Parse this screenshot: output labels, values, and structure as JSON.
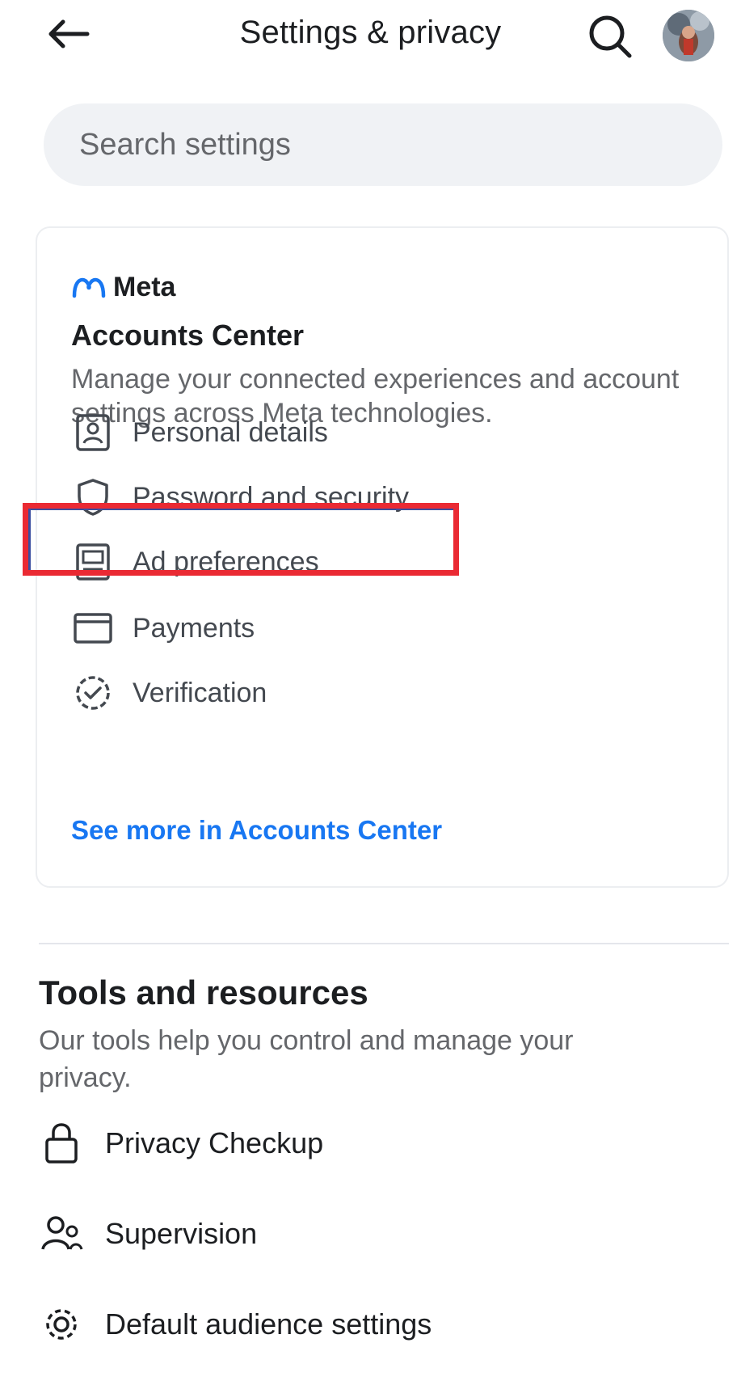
{
  "header": {
    "title": "Settings & privacy"
  },
  "search": {
    "placeholder": "Search settings"
  },
  "accounts_center": {
    "brand": "Meta",
    "title": "Accounts Center",
    "description": "Manage your connected experiences and account settings across Meta technologies.",
    "items": [
      {
        "label": "Personal details",
        "icon": "id-card-icon"
      },
      {
        "label": "Password and security",
        "icon": "shield-icon"
      },
      {
        "label": "Ad preferences",
        "icon": "ad-preferences-icon"
      },
      {
        "label": "Payments",
        "icon": "payment-card-icon"
      },
      {
        "label": "Verification",
        "icon": "verified-badge-icon"
      }
    ],
    "see_more": "See more in Accounts Center"
  },
  "tools": {
    "title": "Tools and resources",
    "description": "Our tools help you control and manage your privacy.",
    "items": [
      {
        "label": "Privacy Checkup",
        "icon": "lock-icon"
      },
      {
        "label": "Supervision",
        "icon": "supervision-icon"
      },
      {
        "label": "Default audience settings",
        "icon": "gear-icon"
      }
    ]
  },
  "colors": {
    "accent": "#1877f2",
    "highlight": "#ea2a33",
    "muted_text": "#65676b"
  }
}
